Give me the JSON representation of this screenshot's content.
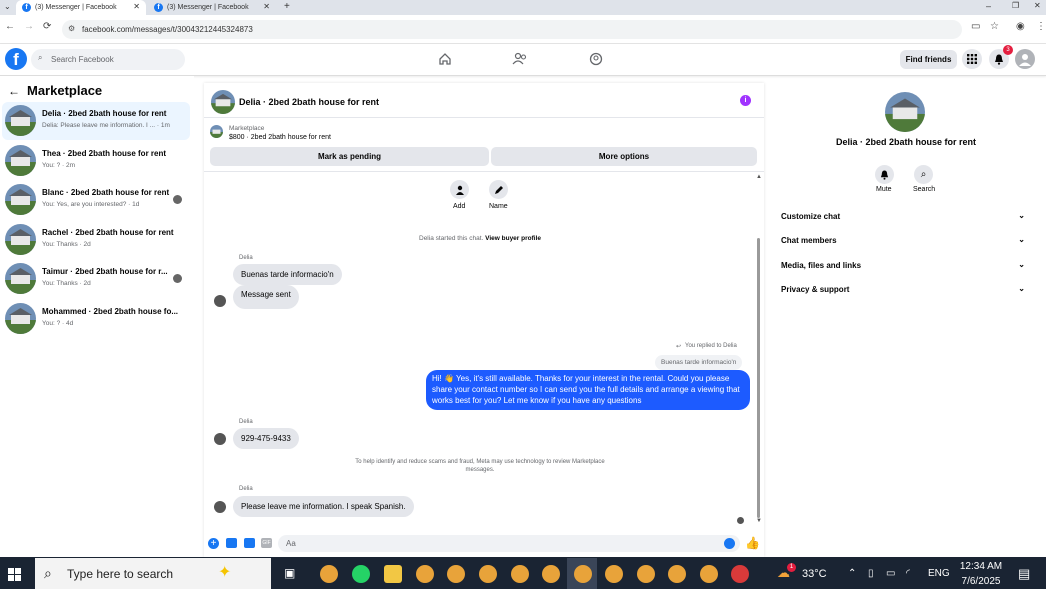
{
  "browser": {
    "tabs": [
      {
        "title": "(3) Messenger | Facebook"
      },
      {
        "title": "(3) Messenger | Facebook"
      }
    ],
    "url": "facebook.com/messages/t/30043212445324873"
  },
  "header": {
    "search_placeholder": "Search Facebook",
    "find_friends": "Find friends",
    "notif_count": "3"
  },
  "sidebar": {
    "title": "Marketplace",
    "conversations": [
      {
        "title": "Delia · 2bed 2bath house for rent",
        "snippet": "Delia: Please leave me information. I ... · 1m"
      },
      {
        "title": "Thea · 2bed 2bath house for rent",
        "snippet": "You: ? · 2m"
      },
      {
        "title": "Blanc · 2bed 2bath house for rent",
        "snippet": "You: Yes, are you interested? · 1d"
      },
      {
        "title": "Rachel · 2bed 2bath house for rent",
        "snippet": "You: Thanks · 2d"
      },
      {
        "title": "Taimur · 2bed 2bath house for r...",
        "snippet": "You: Thanks · 2d"
      },
      {
        "title": "Mohammed · 2bed 2bath house fo...",
        "snippet": "You: ? · 4d"
      }
    ]
  },
  "chat": {
    "header_title": "Delia · 2bed 2bath house for rent",
    "listing_label": "Marketplace",
    "listing_price": "$800 · 2bed 2bath house for rent",
    "mark_pending": "Mark as pending",
    "more_options": "More options",
    "add_label": "Add",
    "name_label": "Name",
    "started_text": "Delia started this chat.",
    "view_profile": "View buyer profile",
    "sender1": "Delia",
    "msg1": "Buenas tarde informacio'n",
    "msg2": "Message sent",
    "replied_to": "You replied to Delia",
    "quoted": "Buenas tarde informacio'n",
    "out_msg": "Hi! 👋 Yes, it's still available. Thanks for your interest in the rental. Could you please share your contact number so I can send you the full details and arrange a viewing that works best for you? Let me know if you have any questions",
    "sender2": "Delia",
    "msg3": "929-475-9433",
    "notice": "To help identify and reduce scams and fraud, Meta may use technology to review Marketplace messages.",
    "sender3": "Delia",
    "msg4": "Please leave me information. I speak Spanish.",
    "composer_placeholder": "Aa"
  },
  "details": {
    "title": "Delia · 2bed 2bath house for rent",
    "mute": "Mute",
    "search": "Search",
    "rows": [
      "Customize chat",
      "Chat members",
      "Media, files and links",
      "Privacy & support"
    ]
  },
  "taskbar": {
    "search_placeholder": "Type here to search",
    "temp": "33°C",
    "lang": "ENG",
    "time": "12:34 AM",
    "date": "7/6/2025",
    "weather_badge": "1"
  },
  "colors": {
    "fb_blue": "#1877f2",
    "bubble_out": "#1d5bff",
    "purple_info": "#a033ff",
    "notif_red": "#e41e3f"
  }
}
